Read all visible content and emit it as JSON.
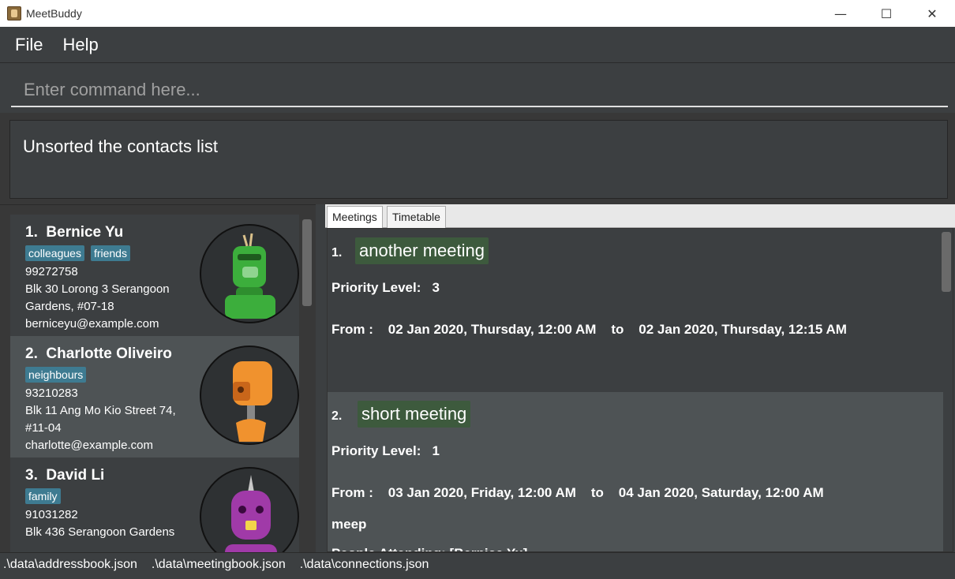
{
  "window": {
    "title": "MeetBuddy",
    "minimize": "—",
    "maximize": "☐",
    "close": "✕"
  },
  "menu": {
    "file": "File",
    "help": "Help"
  },
  "command": {
    "placeholder": "Enter command here..."
  },
  "result": {
    "text": "Unsorted the contacts list"
  },
  "persons": [
    {
      "index": "1.",
      "name": "Bernice Yu",
      "tags": [
        "colleagues",
        "friends"
      ],
      "phone": "99272758",
      "address_line1": "Blk 30 Lorong 3 Serangoon",
      "address_line2": "Gardens, #07-18",
      "email": "berniceyu@example.com",
      "avatar_color": "#3cae3c",
      "avatar_icon": "green-robot-icon"
    },
    {
      "index": "2.",
      "name": "Charlotte Oliveiro",
      "tags": [
        "neighbours"
      ],
      "phone": "93210283",
      "address_line1": "Blk 11 Ang Mo Kio Street 74,",
      "address_line2": "#11-04",
      "email": "charlotte@example.com",
      "avatar_color": "#f0922e",
      "avatar_icon": "orange-robot-icon"
    },
    {
      "index": "3.",
      "name": "David Li",
      "tags": [
        "family"
      ],
      "phone": "91031282",
      "address_line1": "Blk 436 Serangoon Gardens",
      "address_line2": "",
      "email": "",
      "avatar_color": "#a03aa8",
      "avatar_icon": "purple-robot-icon"
    }
  ],
  "tabs": {
    "meetings": "Meetings",
    "timetable": "Timetable"
  },
  "meetings": [
    {
      "index": "1.",
      "title": "another meeting",
      "priority_label": "Priority Level:",
      "priority": "3",
      "from_label": "From :",
      "start": "02 Jan 2020, Thursday, 12:00 AM",
      "to_label": "to",
      "end": "02 Jan 2020, Thursday, 12:15 AM",
      "description": "",
      "attendees": ""
    },
    {
      "index": "2.",
      "title": "short meeting",
      "priority_label": "Priority Level:",
      "priority": "1",
      "from_label": "From :",
      "start": "03 Jan 2020, Friday, 12:00 AM",
      "to_label": "to",
      "end": "04 Jan 2020, Saturday, 12:00 AM",
      "description": "meep",
      "attendees": "People Attending: [Bernice Yu]"
    }
  ],
  "status": {
    "addressbook": ".\\data\\addressbook.json",
    "meetingbook": ".\\data\\meetingbook.json",
    "connections": ".\\data\\connections.json"
  },
  "colors": {
    "background": "#3c3f41",
    "tag": "#3e7b91",
    "meeting_title": "#3d5a3d",
    "selected_row": "#4e5355"
  }
}
